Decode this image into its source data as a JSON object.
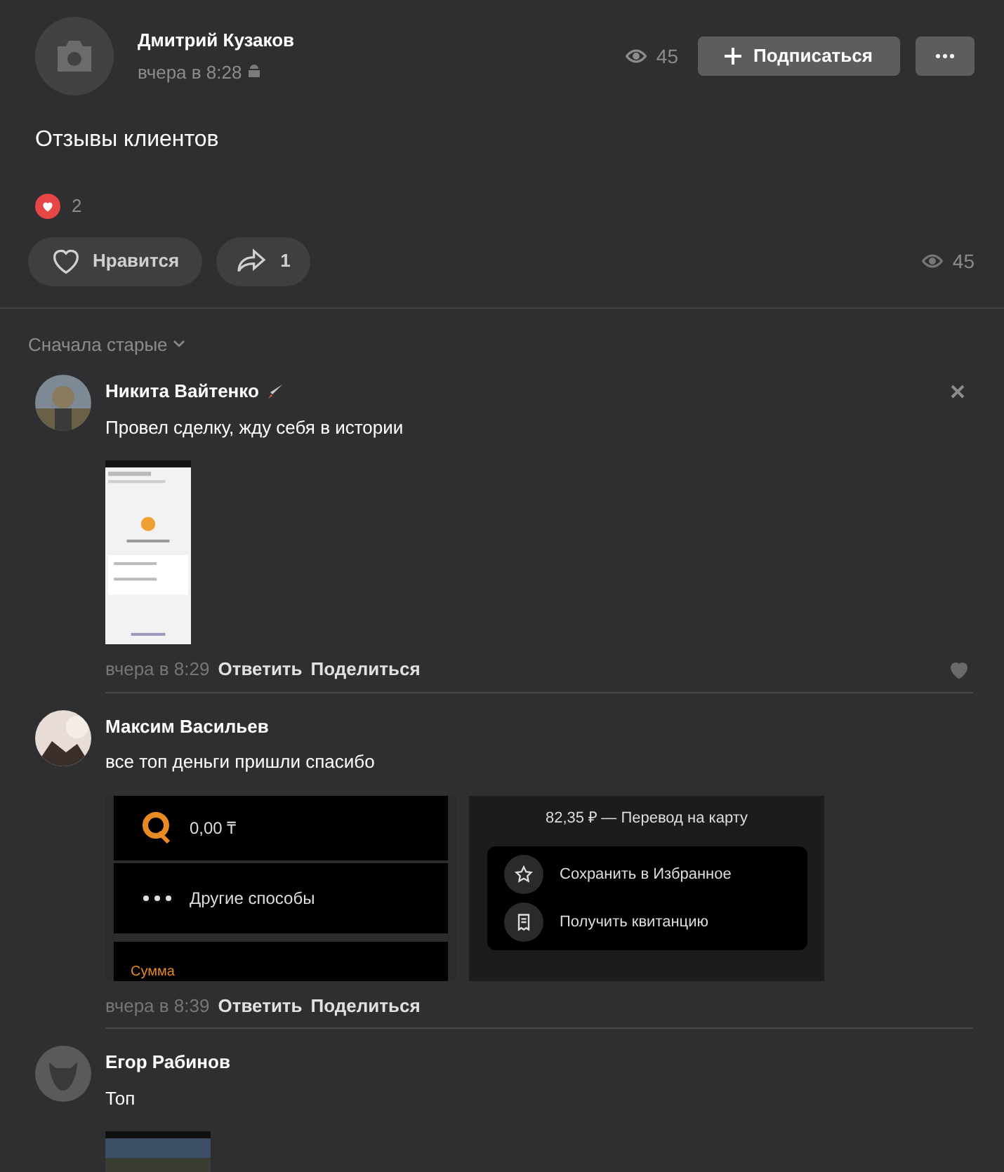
{
  "post": {
    "author": "Дмитрий Кузаков",
    "time": "вчера в 8:28",
    "views": "45",
    "subscribe_label": "Подписаться",
    "text": "Отзывы клиентов",
    "reaction_count": "2",
    "like_label": "Нравится",
    "liked": false,
    "share_count": "1",
    "bottom_views": "45"
  },
  "comments_sort": "Сначала старые",
  "comments": [
    {
      "author": "Никита Вайтенко",
      "text": "Провел сделку, жду себя в истории",
      "time": "вчера в 8:29",
      "reply_label": "Ответить",
      "share_label": "Поделиться",
      "liked": false,
      "closable": true
    },
    {
      "author": "Максим Васильев",
      "text": "все топ деньги пришли спасибо",
      "time": "вчера в 8:39",
      "reply_label": "Ответить",
      "share_label": "Поделиться",
      "attachments": [
        {
          "kind": "wallet",
          "balance": "0,00 ₸",
          "other": "Другие способы",
          "sum_label": "Сумма"
        },
        {
          "kind": "receipt",
          "title": "82,35 ₽ — Перевод на карту",
          "actions": [
            "Сохранить в Избранное",
            "Получить квитанцию"
          ]
        }
      ]
    },
    {
      "author": "Егор Рабинов",
      "text": "Топ"
    }
  ]
}
